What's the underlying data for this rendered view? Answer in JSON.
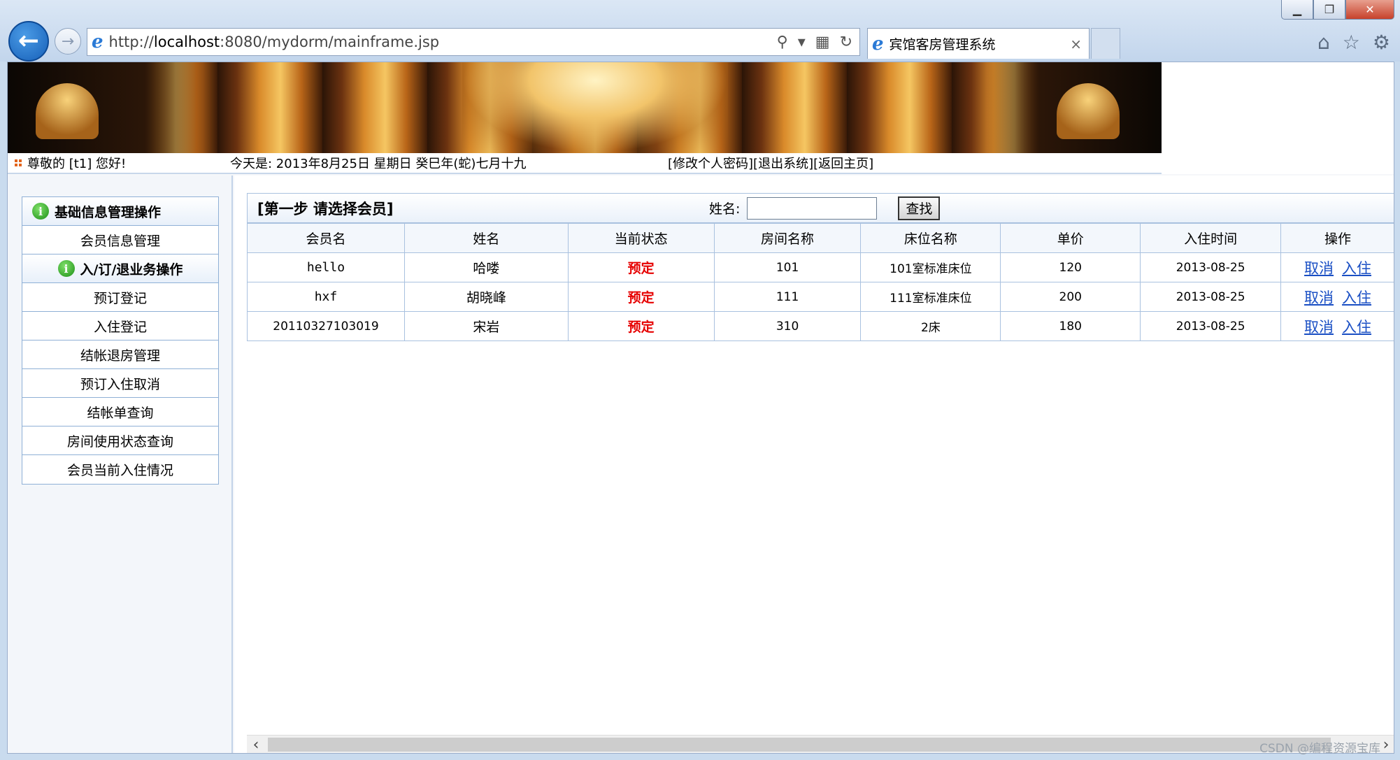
{
  "browser": {
    "url_prefix": "http://",
    "url_host": "localhost",
    "url_rest": ":8080/mydorm/mainframe.jsp",
    "tab_title": "宾馆客房管理系统",
    "tab_close": "×",
    "back_glyph": "←",
    "forward_glyph": "→",
    "window_controls": {
      "min": "▁",
      "max": "❐",
      "close": "✕"
    }
  },
  "infobar": {
    "greeting": "尊敬的 [t1] 您好!",
    "today": "今天是: 2013年8月25日 星期日 癸巳年(蛇)七月十九",
    "change_password": "[修改个人密码]",
    "logout": "[退出系统]",
    "home": "[返回主页]"
  },
  "menu": {
    "basic_header": "基础信息管理操作",
    "member_info": "会员信息管理",
    "checkin_header": "入/订/退业务操作",
    "items": [
      "预订登记",
      "入住登记",
      "结帐退房管理",
      "预订入住取消",
      "结帐单查询",
      "房间使用状态查询",
      "会员当前入住情况"
    ]
  },
  "main": {
    "step_title": "[第一步 请选择会员]",
    "search_label": "姓名:",
    "search_value": "",
    "search_button": "查找",
    "columns": [
      "会员名",
      "姓名",
      "当前状态",
      "房间名称",
      "床位名称",
      "单价",
      "入住时间",
      "操作"
    ],
    "rows": [
      {
        "member": "hello",
        "name": "哈喽",
        "status": "预定",
        "room": "101",
        "bed": "101室标准床位",
        "price": "120",
        "date": "2013-08-25"
      },
      {
        "member": "hxf",
        "name": "胡晓峰",
        "status": "预定",
        "room": "111",
        "bed": "111室标准床位",
        "price": "200",
        "date": "2013-08-25"
      },
      {
        "member": "20110327103019",
        "name": "宋岩",
        "status": "预定",
        "room": "310",
        "bed": "2床",
        "price": "180",
        "date": "2013-08-25"
      }
    ],
    "op_cancel": "取消",
    "op_checkin": "入住"
  },
  "colors": {
    "accent": "#1760b8",
    "status_red": "#e60000",
    "link_blue": "#1a4fc4",
    "border": "#a9c1df"
  },
  "watermark": "CSDN @编程资源宝库"
}
